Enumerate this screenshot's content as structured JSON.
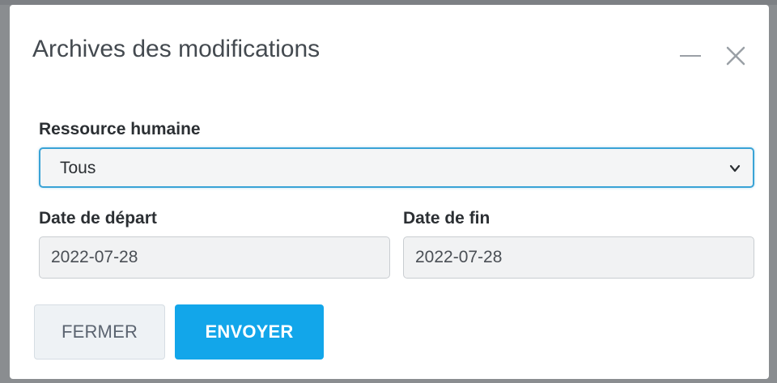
{
  "dialog": {
    "title": "Archives des modifications",
    "controls": {
      "minimize_icon": "minimize-icon",
      "close_icon": "close-icon"
    }
  },
  "form": {
    "resource_label": "Ressource humaine",
    "resource_selected": "Tous",
    "start_date_label": "Date de départ",
    "start_date_value": "2022-07-28",
    "end_date_label": "Date de fin",
    "end_date_value": "2022-07-28"
  },
  "actions": {
    "close_label": "FERMER",
    "send_label": "ENVOYER"
  },
  "colors": {
    "accent": "#12a6ea",
    "focus_border": "#3aa3d6",
    "title_text": "#444a50"
  }
}
